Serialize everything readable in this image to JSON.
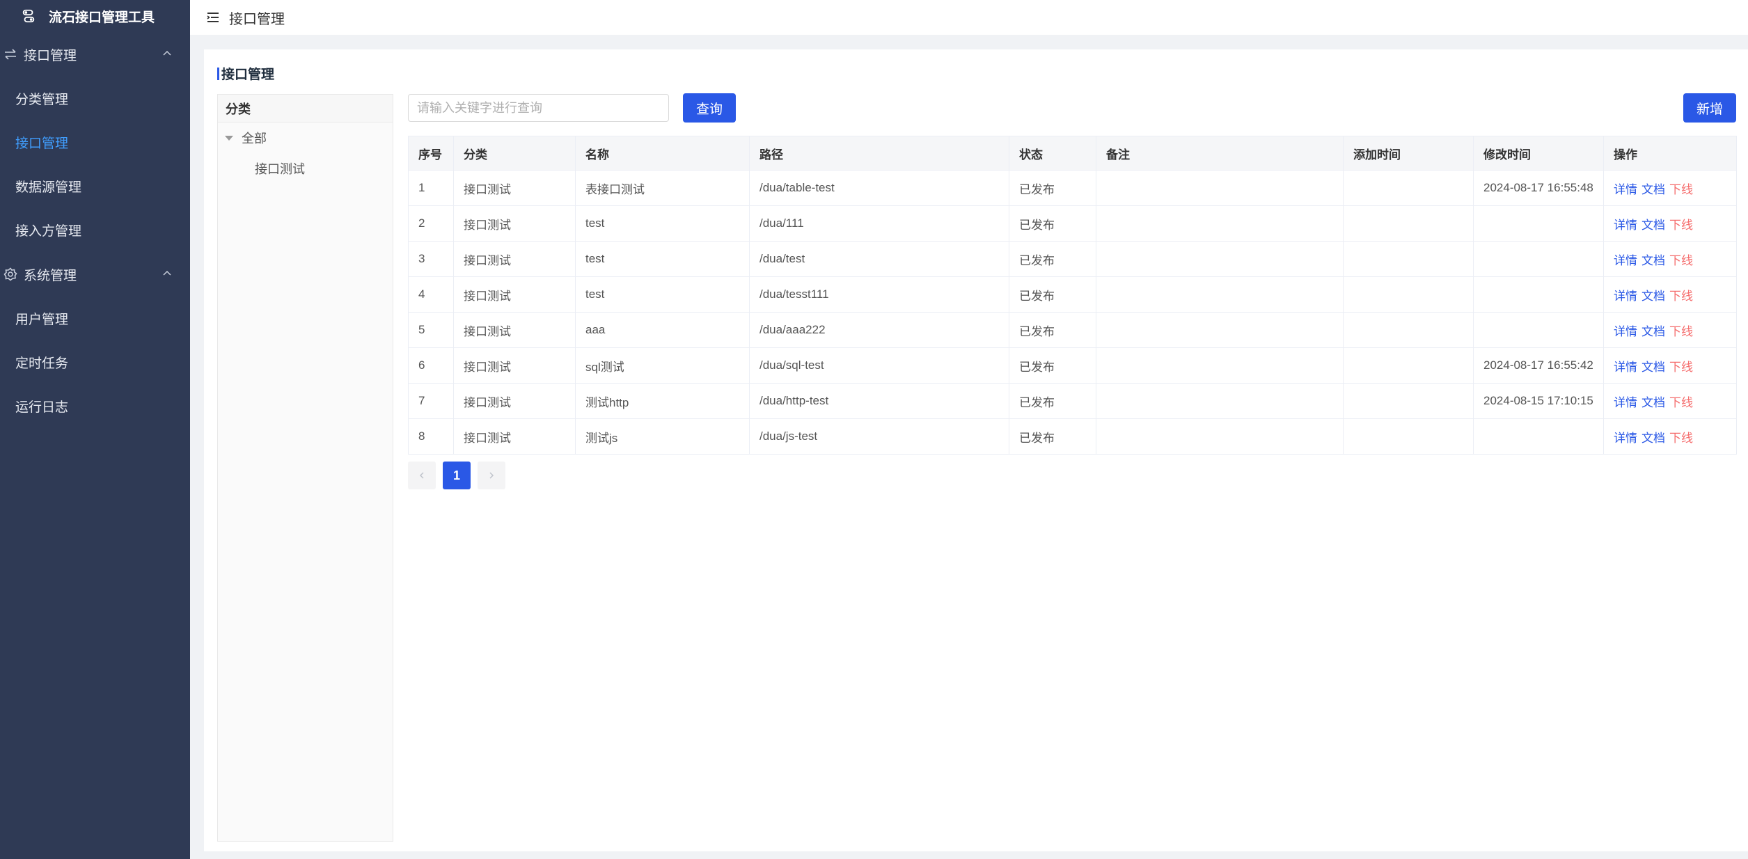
{
  "app": {
    "title": "流石接口管理工具"
  },
  "sidebar": {
    "groups": [
      {
        "label": "接口管理",
        "items": [
          "分类管理",
          "接口管理",
          "数据源管理",
          "接入方管理"
        ]
      },
      {
        "label": "系统管理",
        "items": [
          "用户管理",
          "定时任务",
          "运行日志"
        ]
      }
    ],
    "active_item": "接口管理"
  },
  "header": {
    "breadcrumb": "接口管理"
  },
  "card": {
    "title": "接口管理"
  },
  "tree": {
    "header": "分类",
    "root": "全部",
    "children": [
      "接口测试"
    ]
  },
  "search": {
    "placeholder": "请输入关键字进行查询",
    "value": ""
  },
  "toolbar": {
    "query_label": "查询",
    "add_label": "新增"
  },
  "table": {
    "columns": [
      "序号",
      "分类",
      "名称",
      "路径",
      "状态",
      "备注",
      "添加时间",
      "修改时间",
      "操作"
    ],
    "rows": [
      [
        "1",
        "接口测试",
        "表接口测试",
        "/dua/table-test",
        "已发布",
        "",
        "",
        "2024-08-17 16:55:48"
      ],
      [
        "2",
        "接口测试",
        "test",
        "/dua/111",
        "已发布",
        "",
        "",
        ""
      ],
      [
        "3",
        "接口测试",
        "test",
        "/dua/test",
        "已发布",
        "",
        "",
        ""
      ],
      [
        "4",
        "接口测试",
        "test",
        "/dua/tesst111",
        "已发布",
        "",
        "",
        ""
      ],
      [
        "5",
        "接口测试",
        "aaa",
        "/dua/aaa222",
        "已发布",
        "",
        "",
        ""
      ],
      [
        "6",
        "接口测试",
        "sql测试",
        "/dua/sql-test",
        "已发布",
        "",
        "",
        "2024-08-17 16:55:42"
      ],
      [
        "7",
        "接口测试",
        "测试http",
        "/dua/http-test",
        "已发布",
        "",
        "",
        "2024-08-15 17:10:15"
      ],
      [
        "8",
        "接口测试",
        "测试js",
        "/dua/js-test",
        "已发布",
        "",
        "",
        ""
      ]
    ],
    "actions": [
      "详情",
      "文档",
      "下线"
    ]
  },
  "pagination": {
    "current": "1",
    "prev_icon": "chevron-left-icon",
    "next_icon": "chevron-right-icon"
  },
  "colors": {
    "sidebar_bg": "#2f3a55",
    "accent": "#2a58e6",
    "active_menu": "#409eff",
    "danger": "#f56c6c"
  }
}
